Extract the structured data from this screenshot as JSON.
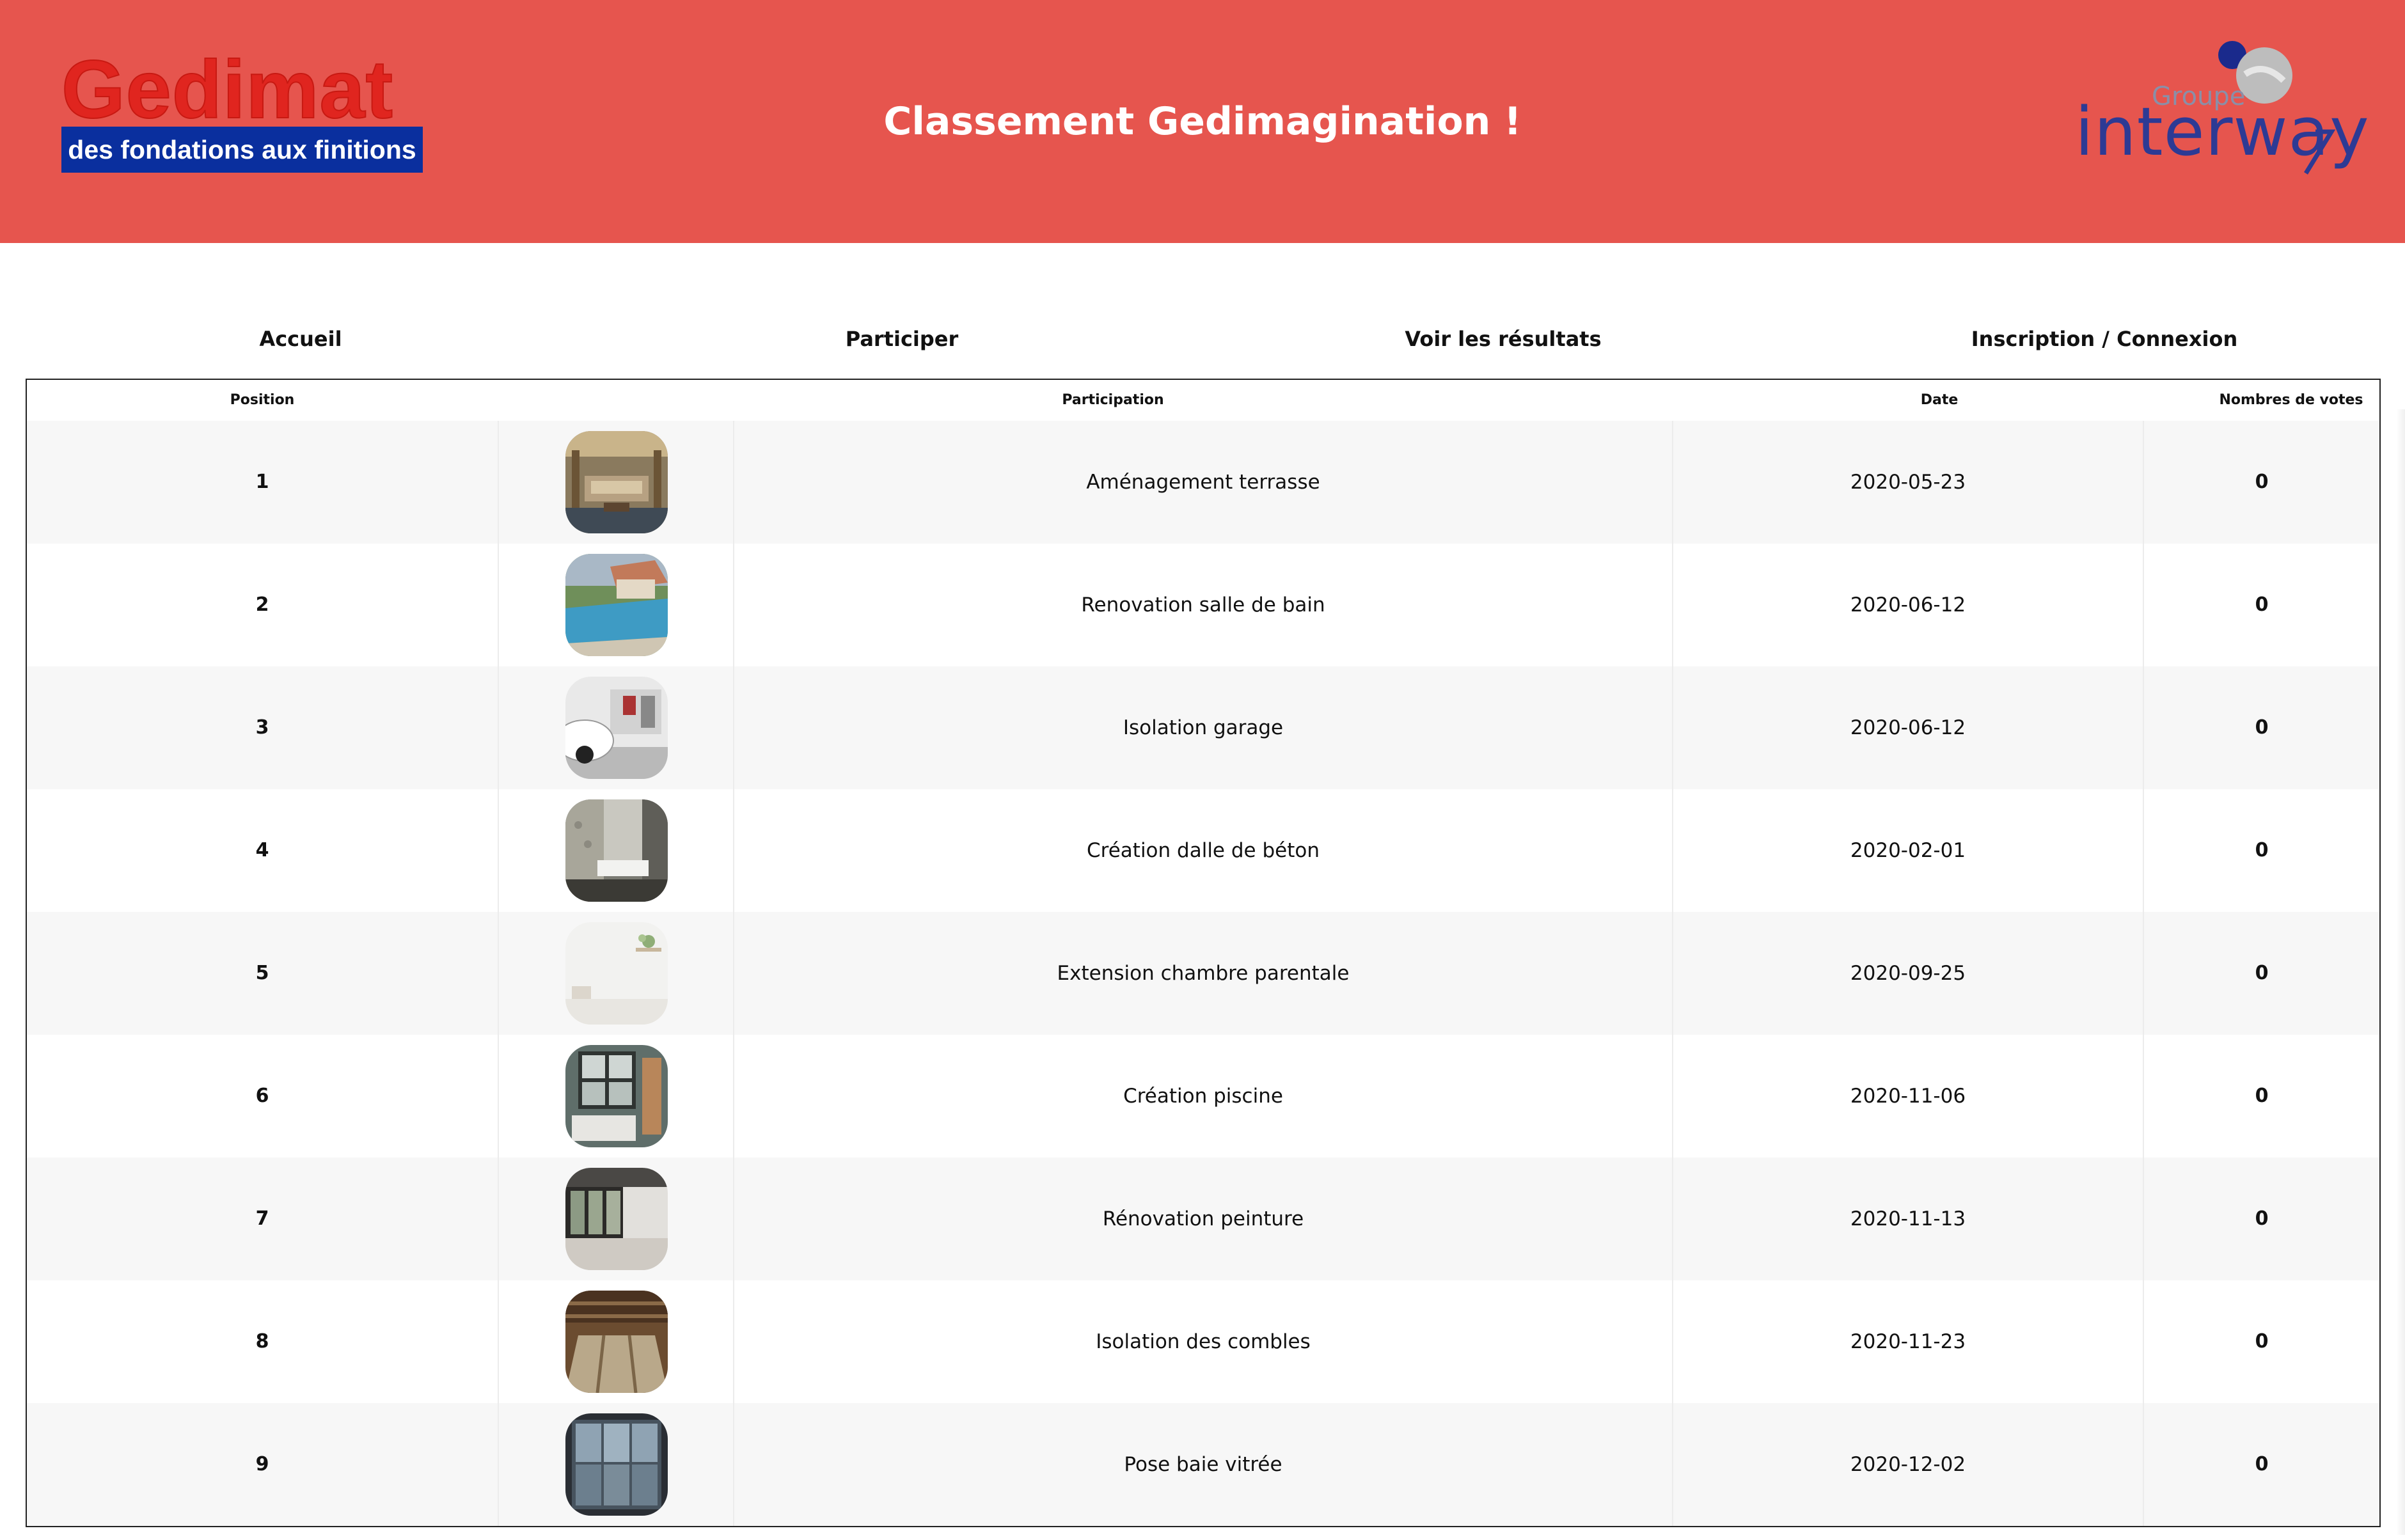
{
  "header": {
    "logo_brand": "Gedimat",
    "logo_tagline": "des fondations aux finitions",
    "title": "Classement Gedimagination !",
    "partner_small": "Groupe",
    "partner_name": "interway",
    "colors": {
      "banner": "#e6554e",
      "gedimat_red": "#e0251f",
      "gedimat_blue": "#0a2f9e",
      "interway_blue": "#2d3a94"
    }
  },
  "nav": {
    "home": "Accueil",
    "participate": "Participer",
    "results": "Voir les résultats",
    "auth": "Inscription / Connexion"
  },
  "table": {
    "headers": {
      "position": "Position",
      "participation": "Participation",
      "date": "Date",
      "votes": "Nombres de votes"
    },
    "rows": [
      {
        "position": "1",
        "name": "Aménagement terrasse",
        "date": "2020-05-23",
        "votes": "0",
        "thumb": "terrace-photo"
      },
      {
        "position": "2",
        "name": "Renovation salle de bain",
        "date": "2020-06-12",
        "votes": "0",
        "thumb": "pool-photo"
      },
      {
        "position": "3",
        "name": "Isolation garage",
        "date": "2020-06-12",
        "votes": "0",
        "thumb": "garage-photo"
      },
      {
        "position": "4",
        "name": "Création dalle de béton",
        "date": "2020-02-01",
        "votes": "0",
        "thumb": "bathroom-photo"
      },
      {
        "position": "5",
        "name": "Extension chambre parentale",
        "date": "2020-09-25",
        "votes": "0",
        "thumb": "white-room-photo"
      },
      {
        "position": "6",
        "name": "Création piscine",
        "date": "2020-11-06",
        "votes": "0",
        "thumb": "bedroom-photo"
      },
      {
        "position": "7",
        "name": "Rénovation peinture",
        "date": "2020-11-13",
        "votes": "0",
        "thumb": "glazed-room-photo"
      },
      {
        "position": "8",
        "name": "Isolation des combles",
        "date": "2020-11-23",
        "votes": "0",
        "thumb": "attic-photo"
      },
      {
        "position": "9",
        "name": "Pose baie vitrée",
        "date": "2020-12-02",
        "votes": "0",
        "thumb": "bay-window-photo"
      }
    ]
  }
}
